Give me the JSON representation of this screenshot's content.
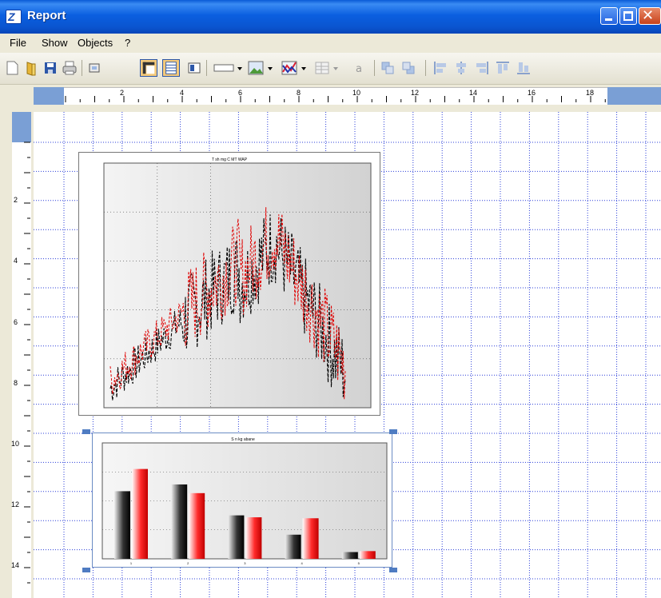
{
  "window": {
    "title": "Report"
  },
  "menu": {
    "items": [
      "File",
      "Show",
      "Objects",
      "?"
    ]
  },
  "toolbar": {
    "icons": [
      "new-icon",
      "open-icon",
      "save-icon",
      "print-icon",
      "frame-icon",
      "ruler-icon",
      "grid-icon",
      "color-icon",
      "rectangle-icon",
      "image-icon",
      "chart-icon",
      "table-icon",
      "text-icon",
      "front-icon",
      "back-icon",
      "align-left-icon",
      "align-center-icon",
      "align-right-icon",
      "align-top-icon",
      "align-bottom-icon"
    ]
  },
  "ruler": {
    "h_labels": [
      "2",
      "4",
      "6",
      "8",
      "10",
      "12",
      "14",
      "16",
      "18"
    ],
    "v_labels": [
      "2",
      "4",
      "6",
      "8",
      "10",
      "12",
      "14"
    ]
  },
  "chart_data": [
    {
      "type": "line",
      "title": "T sh mg C MT WAP",
      "series": [
        {
          "color": "#000000"
        },
        {
          "color": "#e00000"
        }
      ],
      "xlim": [
        0,
        30
      ],
      "ylim": [
        0,
        5
      ],
      "grid": true
    },
    {
      "type": "bar",
      "title": "S n kg abane",
      "categories": [
        "1",
        "2",
        "3",
        "4",
        "5"
      ],
      "series": [
        {
          "color": "#000000",
          "values": [
            7.0,
            7.7,
            4.5,
            2.5,
            0.7
          ]
        },
        {
          "color": "#e00000",
          "values": [
            9.3,
            6.8,
            4.3,
            4.2,
            0.8
          ]
        }
      ],
      "ylim": [
        0,
        12
      ],
      "grid": true
    }
  ]
}
